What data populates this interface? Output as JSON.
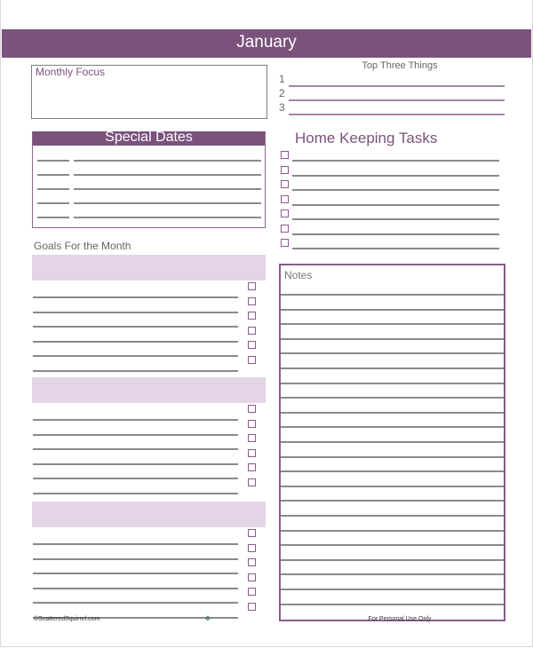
{
  "header": {
    "title": "January"
  },
  "monthly_focus": {
    "label": "Monthly Focus"
  },
  "top_three": {
    "title": "Top Three Things",
    "items": [
      "1",
      "2",
      "3"
    ]
  },
  "special_dates": {
    "title": "Special Dates",
    "row_count": 5
  },
  "goals": {
    "title": "Goals For the Month",
    "groups": 3,
    "lines_per_group": 6
  },
  "home_keeping": {
    "title": "Home Keeping Tasks",
    "task_count": 7
  },
  "notes": {
    "label": "Notes",
    "line_count": 22
  },
  "footer": {
    "copyright": "©ScatteredSquirrel.com",
    "usage": "For Personal Use Only",
    "logo_icon": "squirrel-icon"
  },
  "colors": {
    "accent": "#7b527c",
    "band": "#e3d5e6",
    "line": "#8a8a8a",
    "top3_line": "#a784a8"
  }
}
